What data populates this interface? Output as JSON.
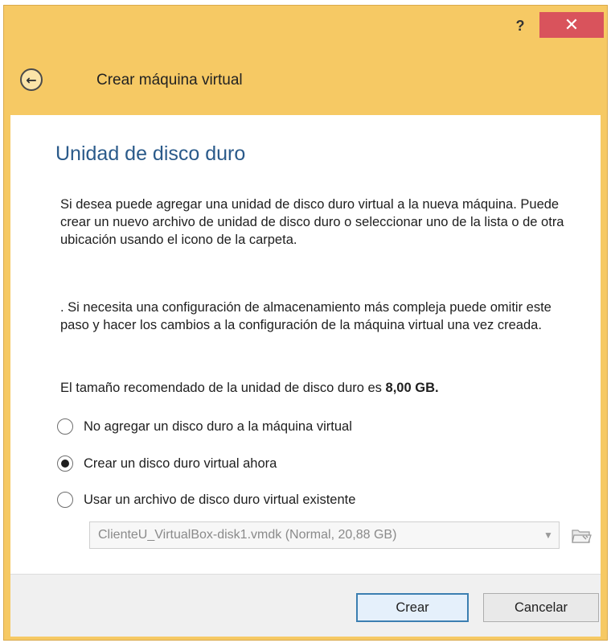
{
  "titlebar": {
    "help_label": "?",
    "close_label": "✕"
  },
  "header": {
    "title": "Crear máquina virtual",
    "back_icon": "back-arrow-icon"
  },
  "page": {
    "title": "Unidad de disco duro",
    "paragraph1": "Si desea puede agregar una unidad de disco duro virtual a la nueva máquina. Puede crear un nuevo archivo de unidad de disco duro o seleccionar uno de la lista o de otra ubicación usando el icono de la carpeta.",
    "paragraph2": ". Si necesita una configuración de almacenamiento más compleja puede omitir este paso y hacer los cambios a la configuración de la máquina virtual una vez creada.",
    "recommended_prefix": "El tamaño recomendado de la unidad de disco duro es ",
    "recommended_size": "8,00 GB."
  },
  "options": [
    {
      "label": "No agregar un disco duro a la máquina virtual",
      "checked": false
    },
    {
      "label": "Crear un disco duro virtual ahora",
      "checked": true
    },
    {
      "label": "Usar un archivo de disco duro virtual existente",
      "checked": false
    }
  ],
  "disk_select": {
    "value": "ClienteU_VirtualBox-disk1.vmdk (Normal, 20,88 GB)",
    "enabled": false
  },
  "buttons": {
    "create": "Crear",
    "cancel": "Cancelar"
  },
  "colors": {
    "accent": "#f6c964",
    "title_blue": "#2a5a8a",
    "close_red": "#d9535c"
  }
}
